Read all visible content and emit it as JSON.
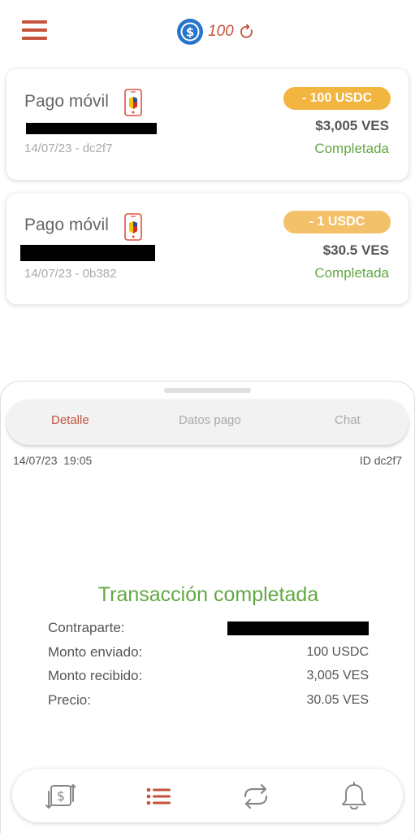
{
  "header": {
    "balance": "100",
    "icons": [
      "menu-icon",
      "usdc-icon",
      "refresh-icon"
    ]
  },
  "transactions": [
    {
      "title": "Pago móvil",
      "meta": "14/07/23 - dc2f7",
      "amount_badge": "- 100 USDC",
      "received": "$3,005 VES",
      "status": "Completada"
    },
    {
      "title": "Pago móvil",
      "meta": "14/07/23 - 0b382",
      "amount_badge": "- 1 USDC",
      "received": "$30.5 VES",
      "status": "Completada"
    }
  ],
  "sheet": {
    "tabs": [
      "Detalle",
      "Datos pago",
      "Chat"
    ],
    "active_tab": "Detalle",
    "date": "14/07/23  19:05",
    "id": "ID dc2f7",
    "headline": "Transacción completada",
    "details": [
      {
        "label": "Contraparte:",
        "value": ""
      },
      {
        "label": "Monto enviado:",
        "value": "100 USDC"
      },
      {
        "label": "Monto recibido:",
        "value": "3,005 VES"
      },
      {
        "label": "Precio:",
        "value": "30.05 VES"
      }
    ]
  },
  "nav": {
    "items": [
      "exchange-icon",
      "list-icon",
      "swap-icon",
      "bell-icon"
    ],
    "active": "list-icon"
  },
  "colors": {
    "accent": "#c5523a",
    "success": "#62a843",
    "badge": "#f1b540",
    "usdc_blue": "#2775ca"
  }
}
